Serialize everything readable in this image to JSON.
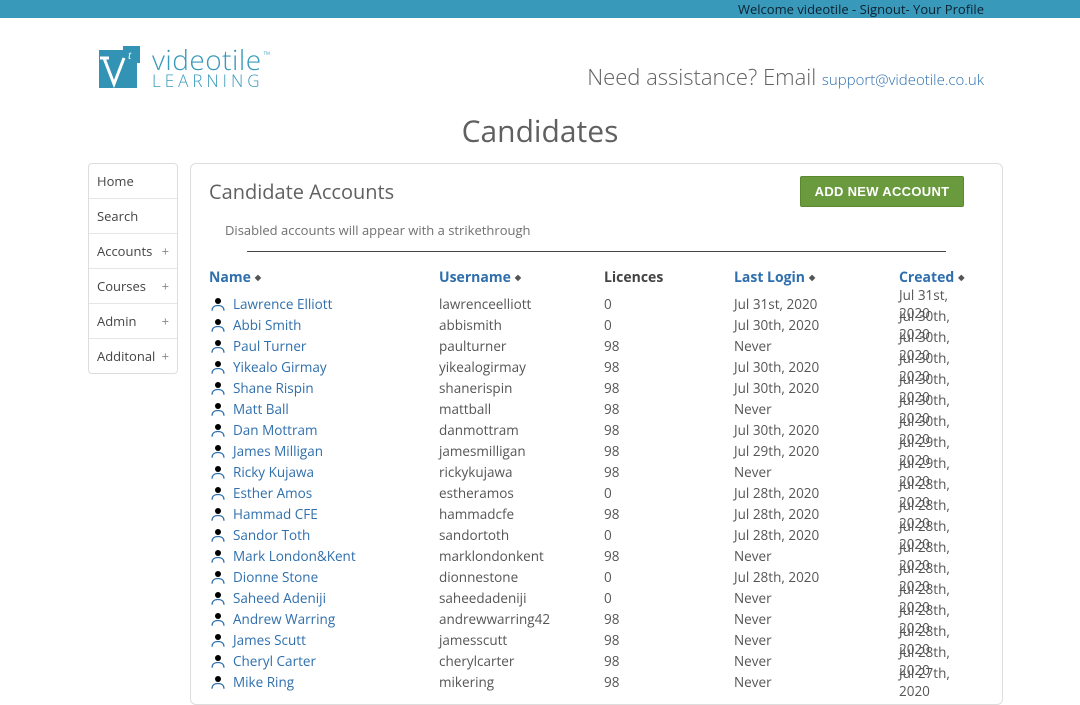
{
  "topbar": {
    "welcome_prefix": "Welcome ",
    "username": "videotile",
    "signout": "Signout",
    "profile": "Your Profile",
    "sep": " - "
  },
  "brand": {
    "line1": "videotile",
    "tm": "™",
    "line2": "LEARNING"
  },
  "assist": {
    "prefix": "Need assistance? Email ",
    "email": "support@videotile.co.uk"
  },
  "page_title": "Candidates",
  "sidebar": [
    {
      "label": "Home",
      "expandable": false
    },
    {
      "label": "Search",
      "expandable": false
    },
    {
      "label": "Accounts",
      "expandable": true
    },
    {
      "label": "Courses",
      "expandable": true
    },
    {
      "label": "Admin",
      "expandable": true
    },
    {
      "label": "Additonal",
      "expandable": true
    }
  ],
  "panel": {
    "title": "Candidate Accounts",
    "add_button": "ADD NEW ACCOUNT",
    "note": "Disabled accounts will appear with a strikethrough"
  },
  "columns": {
    "name": {
      "label": "Name",
      "sortable": true
    },
    "username": {
      "label": "Username",
      "sortable": true
    },
    "licences": {
      "label": "Licences",
      "sortable": false
    },
    "last": {
      "label": "Last Login",
      "sortable": true
    },
    "created": {
      "label": "Created",
      "sortable": true
    }
  },
  "rows": [
    {
      "name": "Lawrence Elliott",
      "user": "lawrenceelliott",
      "lic": "0",
      "last": "Jul 31st, 2020",
      "created": "Jul 31st, 2020"
    },
    {
      "name": "Abbi Smith",
      "user": "abbismith",
      "lic": "0",
      "last": "Jul 30th, 2020",
      "created": "Jul 30th, 2020"
    },
    {
      "name": "Paul Turner",
      "user": "paulturner",
      "lic": "98",
      "last": "Never",
      "created": "Jul 30th, 2020"
    },
    {
      "name": "Yikealo Girmay",
      "user": "yikealogirmay",
      "lic": "98",
      "last": "Jul 30th, 2020",
      "created": "Jul 30th, 2020"
    },
    {
      "name": "Shane Rispin",
      "user": "shanerispin",
      "lic": "98",
      "last": "Jul 30th, 2020",
      "created": "Jul 30th, 2020"
    },
    {
      "name": "Matt Ball",
      "user": "mattball",
      "lic": "98",
      "last": "Never",
      "created": "Jul 30th, 2020"
    },
    {
      "name": "Dan Mottram",
      "user": "danmottram",
      "lic": "98",
      "last": "Jul 30th, 2020",
      "created": "Jul 30th, 2020"
    },
    {
      "name": "James Milligan",
      "user": "jamesmilligan",
      "lic": "98",
      "last": "Jul 29th, 2020",
      "created": "Jul 29th, 2020"
    },
    {
      "name": "Ricky Kujawa",
      "user": "rickykujawa",
      "lic": "98",
      "last": "Never",
      "created": "Jul 29th, 2020"
    },
    {
      "name": "Esther Amos",
      "user": "estheramos",
      "lic": "0",
      "last": "Jul 28th, 2020",
      "created": "Jul 28th, 2020"
    },
    {
      "name": "Hammad CFE",
      "user": "hammadcfe",
      "lic": "98",
      "last": "Jul 28th, 2020",
      "created": "Jul 28th, 2020"
    },
    {
      "name": "Sandor Toth",
      "user": "sandortoth",
      "lic": "0",
      "last": "Jul 28th, 2020",
      "created": "Jul 28th, 2020"
    },
    {
      "name": "Mark London&Kent",
      "user": "marklondonkent",
      "lic": "98",
      "last": "Never",
      "created": "Jul 28th, 2020"
    },
    {
      "name": "Dionne Stone",
      "user": "dionnestone",
      "lic": "0",
      "last": "Jul 28th, 2020",
      "created": "Jul 28th, 2020"
    },
    {
      "name": "Saheed Adeniji",
      "user": "saheedadeniji",
      "lic": "0",
      "last": "Never",
      "created": "Jul 28th, 2020"
    },
    {
      "name": "Andrew Warring",
      "user": "andrewwarring42",
      "lic": "98",
      "last": "Never",
      "created": "Jul 28th, 2020"
    },
    {
      "name": "James Scutt",
      "user": "jamesscutt",
      "lic": "98",
      "last": "Never",
      "created": "Jul 28th, 2020"
    },
    {
      "name": "Cheryl Carter",
      "user": "cherylcarter",
      "lic": "98",
      "last": "Never",
      "created": "Jul 28th, 2020"
    },
    {
      "name": "Mike Ring",
      "user": "mikering",
      "lic": "98",
      "last": "Never",
      "created": "Jul 27th, 2020"
    }
  ]
}
